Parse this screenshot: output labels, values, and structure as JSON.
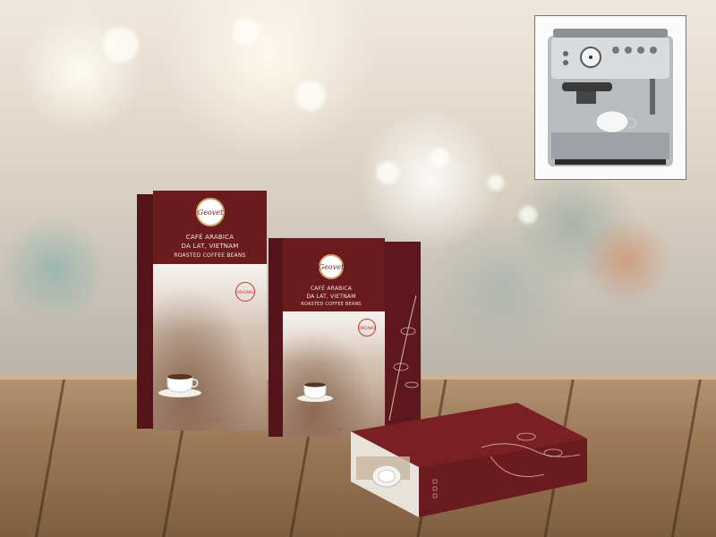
{
  "scene": {
    "background": "blurred coffee shop",
    "surface": "wooden table",
    "colors": {
      "box_maroon": "#6b1a1d",
      "box_side": "#55141a",
      "accent_gold": "#caa76a"
    }
  },
  "product": {
    "brand_logo": "Geovet",
    "line1": "CAFÉ ARABICA",
    "line2": "DA LAT, VIETNAM",
    "line3": "ROASTED COFFEE BEANS",
    "stamp": "ORIGINAL",
    "weight_large": "500gr",
    "weight_medium": "250gr"
  },
  "inset": {
    "icon": "espresso-machine-icon"
  }
}
